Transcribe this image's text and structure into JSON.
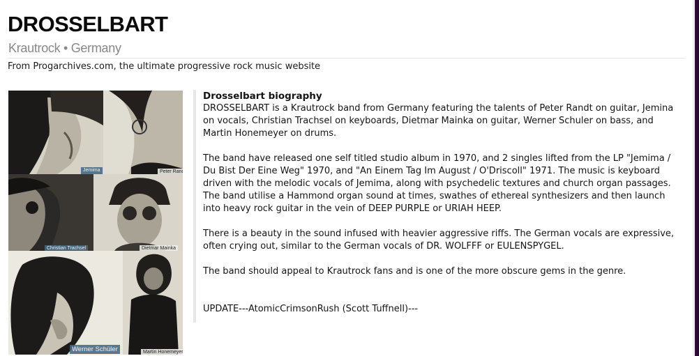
{
  "header": {
    "title": "DROSSELBART",
    "subtitle": "Krautrock • Germany",
    "source_text": "From Progarchives.com, the ultimate progressive rock music website"
  },
  "photo": {
    "captions": {
      "jemima": "Jemima",
      "peter": "Peter Randt",
      "christian": "Christian Trachsel",
      "dietmar": "Dietmar Mainka",
      "werner": "Werner Schüler",
      "martin": "Martin Honemeyer"
    }
  },
  "bio": {
    "heading": "Drosselbart biography",
    "paragraphs": [
      "DROSSELBART is a Krautrock band from Germany featuring the talents of Peter Randt on guitar, Jemina on vocals, Christian Trachsel on keyboards, Dietmar Mainka on guitar, Werner Schuler on bass, and Martin Honemeyer on drums.",
      "The band have released one self titled studio album in 1970, and 2 singles lifted from the LP \"Jemima / Du Bist Der Eine Weg\" 1970, and \"An Einem Tag Im August / O'Driscoll\" 1971. The music is keyboard driven with the melodic vocals of Jemima, along with psychedelic textures and church organ passages. The band utilise a Hammond organ sound at times, swathes of ethereal synthesizers and then launch into heavy rock guitar in the vein of DEEP PURPLE or URIAH HEEP.",
      "There is a beauty in the sound infused with heavier aggressive riffs. The German vocals are expressive, often crying out, similar to the German vocals of DR. WOLFFF or EULENSPYGEL.",
      "The band should appeal to Krautrock fans and is one of the more obscure gems in the genre."
    ],
    "update": "UPDATE---AtomicCrimsonRush (Scott Tuffnell)---"
  },
  "colors": {
    "accent_bar": "#2a0a33",
    "subtitle": "#888888"
  }
}
